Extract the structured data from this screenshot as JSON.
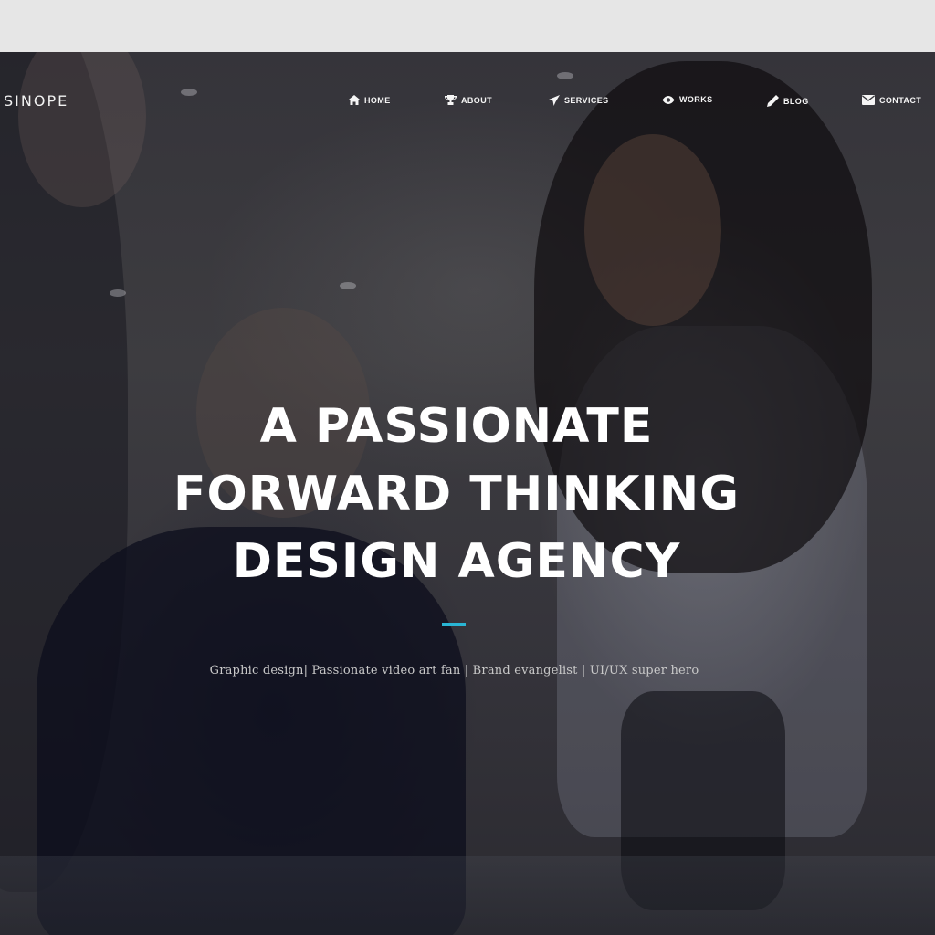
{
  "brand": {
    "logo_text": "SINOPE"
  },
  "nav": {
    "items": [
      {
        "label": "HOME",
        "icon": "home-icon"
      },
      {
        "label": "ABOUT",
        "icon": "trophy-icon"
      },
      {
        "label": "SERVICES",
        "icon": "paper-plane-icon"
      },
      {
        "label": "WORKS",
        "icon": "eye-icon"
      },
      {
        "label": "BLOG",
        "icon": "pencil-icon"
      },
      {
        "label": "CONTACT",
        "icon": "envelope-icon"
      }
    ]
  },
  "hero": {
    "headline_lines": [
      "A PASSIONATE",
      "FORWARD THINKING",
      "DESIGN AGENCY"
    ],
    "tagline": "Graphic design| Passionate video art fan | Brand evangelist | UI/UX super hero"
  },
  "colors": {
    "accent": "#29b5d4",
    "text": "#ffffff",
    "overlay": "#35343a"
  }
}
